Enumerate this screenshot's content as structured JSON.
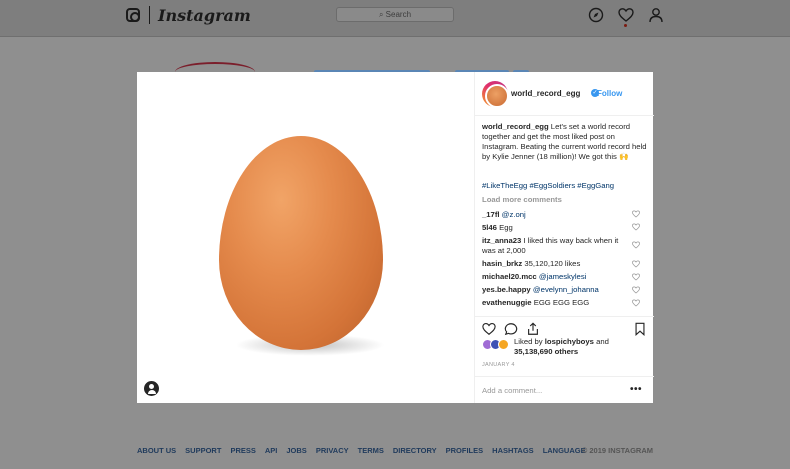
{
  "header": {
    "logo_text": "Instagram",
    "search_placeholder": "Search",
    "icons": [
      "instagram-logo-icon",
      "compass-icon",
      "heart-icon",
      "profile-icon"
    ]
  },
  "post": {
    "username": "world_record_egg",
    "follow_label": "Follow",
    "caption_user": "world_record_egg",
    "caption_text": "Let's set a world record together and get the most liked post on Instagram. Beating the current world record held by Kylie Jenner (18 million)! We got this 🙌",
    "hashtags": "#LikeTheEgg #EggSoldiers #EggGang",
    "load_more": "Load more comments",
    "comments": [
      {
        "user": "_17fl",
        "text": "@z.onj",
        "mention": true
      },
      {
        "user": "5l46",
        "text": "Egg",
        "mention": false
      },
      {
        "user": "itz_anna23",
        "text": "I liked this way back when it was at 2,000",
        "mention": false
      },
      {
        "user": "hasin_brkz",
        "text": "35,120,120 likes",
        "mention": false
      },
      {
        "user": "michael20.mcc",
        "text": "@jameskylesi",
        "mention": true
      },
      {
        "user": "yes.be.happy",
        "text": "@evelynn_johanna",
        "mention": true
      },
      {
        "user": "evathenuggie",
        "text": "EGG EGG EGG",
        "mention": false
      }
    ],
    "liked_by_prefix": "Liked by",
    "liked_by_user": "lospichyboys",
    "liked_by_and": "and",
    "liked_by_others": "35,138,690 others",
    "date": "JANUARY 4",
    "add_comment_placeholder": "Add a comment...",
    "more_label": "•••"
  },
  "footer": {
    "links": [
      "ABOUT US",
      "SUPPORT",
      "PRESS",
      "API",
      "JOBS",
      "PRIVACY",
      "TERMS",
      "DIRECTORY",
      "PROFILES",
      "HASHTAGS",
      "LANGUAGE"
    ],
    "copyright": "© 2019 INSTAGRAM"
  },
  "colors": {
    "link_blue": "#3897f0",
    "hashtag_blue": "#003569",
    "egg": "#e58b4d"
  }
}
